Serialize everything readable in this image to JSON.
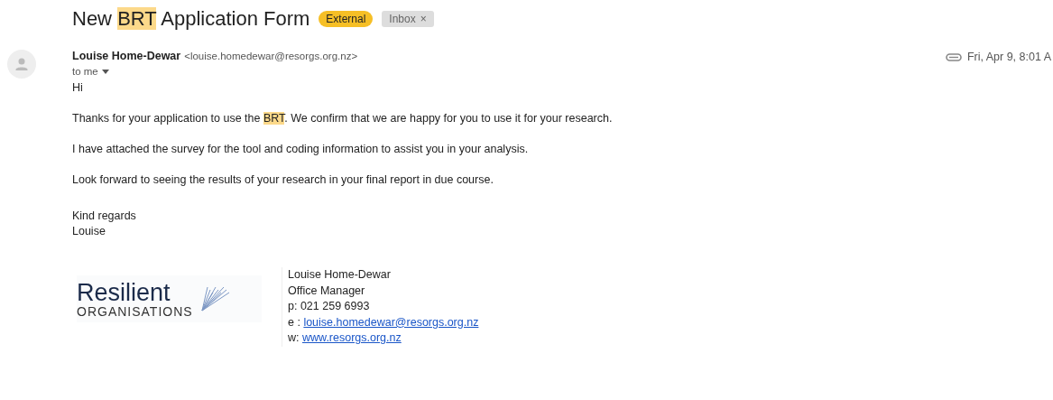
{
  "subject": [
    {
      "text": "New ",
      "highlighted": false
    },
    {
      "text": "BRT",
      "highlighted": true
    },
    {
      "text": " Application Form",
      "highlighted": false
    }
  ],
  "labels": [
    {
      "text": "External",
      "kind": "external"
    },
    {
      "text": "Inbox",
      "kind": "inbox",
      "close": "×"
    }
  ],
  "sender": {
    "name": "Louise Home-Dewar",
    "email": "<louise.homedewar@resorgs.org.nz>",
    "recipient": "to me",
    "date": "Fri, Apr 9, 8:01 A"
  },
  "body": [
    [
      {
        "text": "Hi",
        "highlighted": false
      }
    ],
    [
      {
        "text": "Thanks for your application to use the ",
        "highlighted": false
      },
      {
        "text": "BRT",
        "highlighted": true
      },
      {
        "text": ". We confirm that we are happy for you to use it for your research.",
        "highlighted": false
      }
    ],
    [
      {
        "text": "I have attached the survey for the tool and coding information to assist you in your analysis.",
        "highlighted": false
      }
    ],
    [
      {
        "text": "Look forward to seeing the results of your research in your final report in due course.",
        "highlighted": false
      }
    ]
  ],
  "closing": [
    "Kind regards",
    "Louise"
  ],
  "signature": {
    "logo": {
      "word": "Resilient",
      "subword": "ORGANISATIONS"
    },
    "lines": [
      {
        "kind": "text",
        "text": "Louise Home-Dewar"
      },
      {
        "kind": "text",
        "text": "Office Manager"
      },
      {
        "kind": "text",
        "text": "p: 021 259 6993"
      },
      {
        "kind": "link",
        "prefix": "e : ",
        "text": "louise.homedewar@resorgs.org.nz"
      },
      {
        "kind": "link",
        "prefix": "w: ",
        "text": "www.resorgs.org.nz"
      }
    ]
  }
}
